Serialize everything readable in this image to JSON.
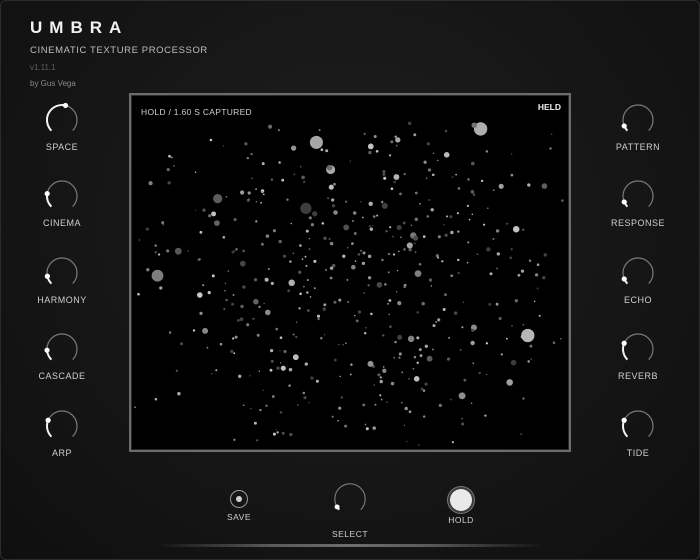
{
  "brand": {
    "title": "UMBRA",
    "subtitle": "CINEMATIC TEXTURE PROCESSOR",
    "version": "v1.11.1",
    "author": "by Gus Vega"
  },
  "knobs_left": [
    {
      "label": "SPACE",
      "value": 0.55
    },
    {
      "label": "CINEMA",
      "value": 0.2
    },
    {
      "label": "HARMONY",
      "value": 0.12
    },
    {
      "label": "CASCADE",
      "value": 0.15
    },
    {
      "label": "ARP",
      "value": 0.25
    }
  ],
  "knobs_right": [
    {
      "label": "PATTERN",
      "value": 0.08
    },
    {
      "label": "RESPONSE",
      "value": 0.08
    },
    {
      "label": "ECHO",
      "value": 0.08
    },
    {
      "label": "REVERB",
      "value": 0.25
    },
    {
      "label": "TIDE",
      "value": 0.25
    }
  ],
  "display": {
    "status": "HOLD  /  1.60 S CAPTURED",
    "badge": "HELD"
  },
  "bottom": {
    "save_label": "SAVE",
    "select_label": "SELECT",
    "hold_label": "HOLD",
    "select_value": 0.05
  },
  "colors": {
    "background": "#151515",
    "display_bg": "#000000",
    "accent": "#f0f0f0"
  }
}
